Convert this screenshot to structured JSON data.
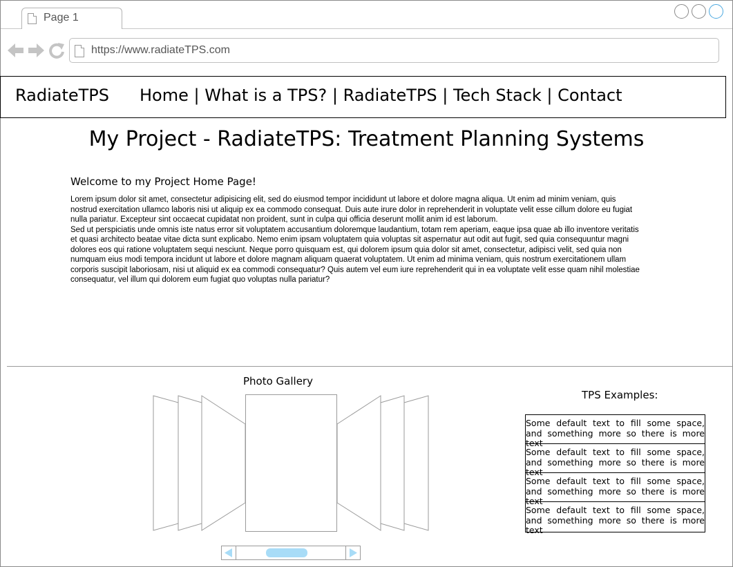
{
  "browser": {
    "tab_title": "Page 1",
    "url": "https://www.radiateTPS.com",
    "window_buttons": [
      "minimize",
      "maximize",
      "close"
    ]
  },
  "site": {
    "brand": "RadiateTPS",
    "nav": [
      "Home",
      "What is a TPS?",
      "RadiateTPS",
      "Tech Stack",
      "Contact"
    ],
    "nav_separator": "|"
  },
  "page": {
    "title": "My Project - RadiateTPS: Treatment Planning Systems",
    "welcome": "Welcome to my Project Home Page!",
    "paragraph_1": "Lorem ipsum dolor sit amet, consectetur adipisicing elit, sed do eiusmod tempor incididunt ut labore et dolore magna aliqua. Ut enim ad minim veniam, quis nostrud exercitation ullamco laboris nisi ut aliquip ex ea commodo consequat. Duis aute irure dolor in reprehenderit in voluptate velit esse cillum dolore eu fugiat nulla pariatur. Excepteur sint occaecat cupidatat non proident, sunt in culpa qui officia deserunt mollit anim id est laborum.",
    "paragraph_2": "Sed ut perspiciatis unde omnis iste natus error sit voluptatem accusantium doloremque laudantium, totam rem aperiam, eaque ipsa quae ab illo inventore veritatis et quasi architecto beatae vitae dicta sunt explicabo. Nemo enim ipsam voluptatem quia voluptas sit aspernatur aut odit aut fugit, sed quia consequuntur magni dolores eos qui ratione voluptatem sequi nesciunt. Neque porro quisquam est, qui dolorem ipsum quia dolor sit amet, consectetur, adipisci velit, sed quia non numquam eius modi tempora incidunt ut labore et dolore magnam aliquam quaerat voluptatem. Ut enim ad minima veniam, quis nostrum exercitationem ullam corporis suscipit laboriosam, nisi ut aliquid ex ea commodi consequatur? Quis autem vel eum iure reprehenderit qui in ea voluptate velit esse quam nihil molestiae consequatur, vel illum qui dolorem eum fugiat quo voluptas nulla pariatur?"
  },
  "gallery": {
    "label": "Photo Gallery"
  },
  "tps": {
    "label": "TPS Examples:",
    "items": [
      {
        "line1": "Some default text to fill some space,",
        "line2": "and something more so there is more text"
      },
      {
        "line1": "Some default text to fill some space,",
        "line2": "and something more so there is more text"
      },
      {
        "line1": "Some default text to fill some space,",
        "line2": "and something more so there is more text"
      },
      {
        "line1": "Some default text to fill some space,",
        "line2": "and something more so there is more text"
      }
    ]
  },
  "colors": {
    "scroll_thumb": "#a8dcf7",
    "scroll_arrow": "#a8dcf7",
    "active_window_button": "#4aa8e0"
  }
}
